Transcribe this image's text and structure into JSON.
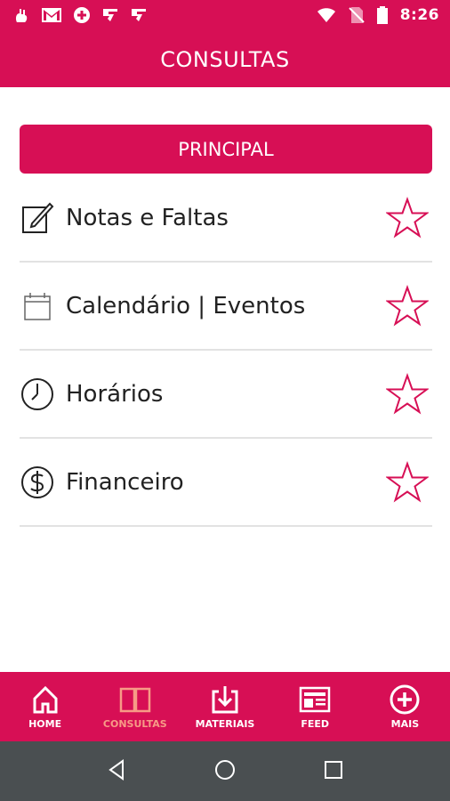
{
  "status_bar": {
    "time": "8:26",
    "left_icons": [
      "gesture-icon",
      "gmail-icon",
      "app-plus-icon",
      "check-app-icon",
      "check-app-icon"
    ],
    "right_icons": [
      "wifi-icon",
      "no-signal-icon",
      "battery-icon"
    ]
  },
  "app_bar": {
    "title": "CONSULTAS"
  },
  "section": {
    "header": "PRINCIPAL"
  },
  "menu": {
    "items": [
      {
        "label": "Notas e Faltas",
        "icon": "edit-note-icon"
      },
      {
        "label": "Calendário | Eventos",
        "icon": "calendar-icon"
      },
      {
        "label": "Horários",
        "icon": "clock-icon"
      },
      {
        "label": "Financeiro",
        "icon": "dollar-icon"
      }
    ]
  },
  "bottom_nav": {
    "items": [
      {
        "label": "HOME",
        "icon": "home-icon"
      },
      {
        "label": "CONSULTAS",
        "icon": "book-icon",
        "active": true
      },
      {
        "label": "MATERIAIS",
        "icon": "download-icon"
      },
      {
        "label": "FEED",
        "icon": "news-icon"
      },
      {
        "label": "MAIS",
        "icon": "plus-circle-icon"
      }
    ]
  },
  "colors": {
    "primary": "#d70f55",
    "active_nav": "#f79b86",
    "star": "#d70f55",
    "android_nav": "#4a4f51"
  }
}
